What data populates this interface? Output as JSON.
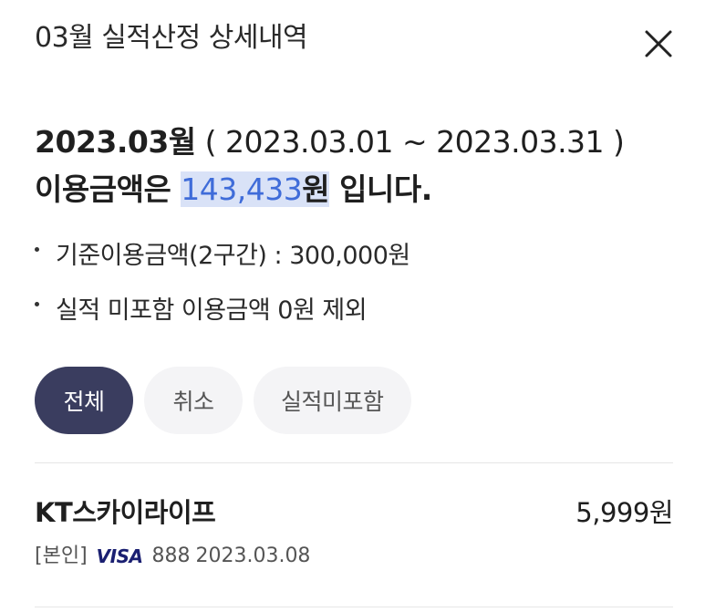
{
  "header": {
    "title": "03월 실적산정 상세내역"
  },
  "summary": {
    "period": "2023.03월",
    "range": " ( 2023.03.01 ~ 2023.03.31 )",
    "prefix": "이용금액은 ",
    "amount": "143,433",
    "suffix_won": "원",
    "suffix_rest": " 입니다."
  },
  "bullets": [
    "기준이용금액(2구간) : 300,000원",
    "실적 미포함 이용금액 0원 제외"
  ],
  "filters": {
    "selected": "전체",
    "options": [
      "전체",
      "취소",
      "실적미포함"
    ]
  },
  "transactions": [
    {
      "merchant": "KT스카이라이프",
      "amount": "5,999원",
      "owner": "[본인]",
      "card_brand": "VISA",
      "card_last": "888",
      "date": "2023.03.08"
    }
  ],
  "icons": {
    "close": "close-icon",
    "card_brand": "visa-logo"
  },
  "colors": {
    "accent_blue": "#3f6cd9",
    "highlight": "#d9e2f7",
    "active_chip": "#3a3d5f",
    "chip_bg": "#f4f4f6",
    "visa": "#1a1f71"
  }
}
